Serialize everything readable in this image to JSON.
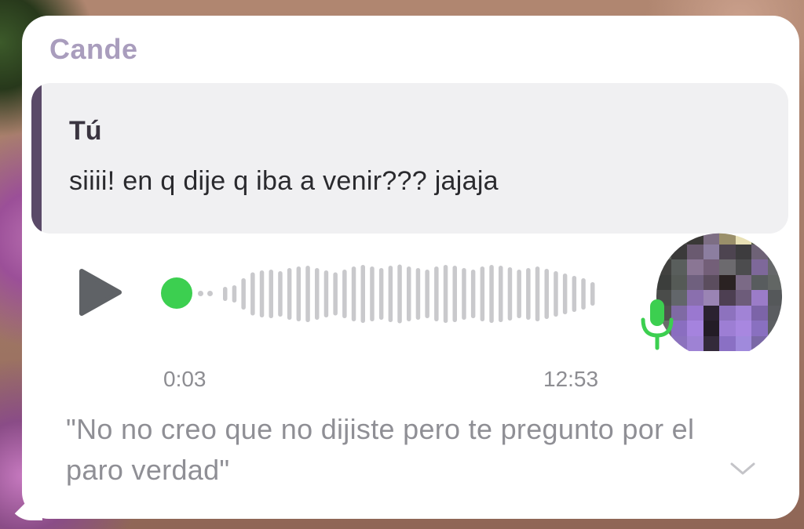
{
  "message": {
    "sender": "Cande",
    "reply_quote": {
      "author": "Tú",
      "text": "siiii! en q dije q iba a venir??? jajaja"
    },
    "voice_note": {
      "duration": "0:03",
      "progress": 0,
      "waveform_levels": [
        0.18,
        0.22,
        0.4,
        0.55,
        0.6,
        0.62,
        0.58,
        0.66,
        0.7,
        0.72,
        0.66,
        0.6,
        0.55,
        0.62,
        0.7,
        0.74,
        0.7,
        0.66,
        0.72,
        0.75,
        0.7,
        0.66,
        0.62,
        0.7,
        0.74,
        0.72,
        0.66,
        0.62,
        0.7,
        0.74,
        0.72,
        0.68,
        0.62,
        0.66,
        0.7,
        0.64,
        0.58,
        0.52,
        0.46,
        0.4,
        0.3
      ],
      "played_color": "#3ccf50",
      "unplayed_color": "#c9c9cc",
      "icons": {
        "play": "play-icon",
        "mic": "microphone-icon",
        "mic_color": "#3ccf50"
      }
    },
    "time_sent": "12:53",
    "transcript": "\"No no creo que no dijiste pero te pregunto por el paro verdad\"",
    "expand_icon": "chevron-down-icon"
  },
  "colors": {
    "bubble": "#ffffff",
    "quote_background": "#f0f0f2",
    "quote_bar": "#5a4a68",
    "sender_name": "#a99dbd",
    "secondary_text": "#8d8d92"
  }
}
